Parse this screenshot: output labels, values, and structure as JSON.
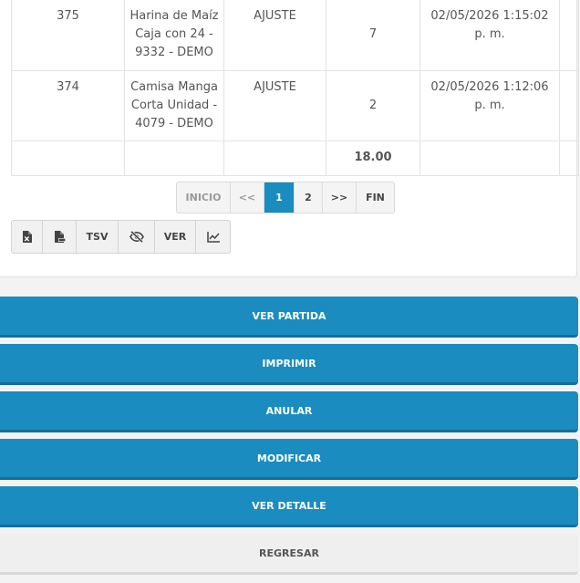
{
  "table": {
    "rows": [
      {
        "id": "375",
        "product": "Harina de Maíz Caja con 24 - 9332 - DEMO",
        "type": "AJUSTE",
        "qty": "7",
        "date": "02/05/2026 1:15:02 p. m."
      },
      {
        "id": "374",
        "product": "Camisa Manga Corta Unidad - 4079 - DEMO",
        "type": "AJUSTE",
        "qty": "2",
        "date": "02/05/2026 1:12:06 p. m."
      }
    ],
    "total": "18.00"
  },
  "pagination": {
    "first": "INICIO",
    "prev": "<<",
    "pages": [
      "1",
      "2"
    ],
    "current_page": "1",
    "next": ">>",
    "last": "FIN"
  },
  "toolbar": {
    "excel_icon": "excel-file-icon",
    "pdf_icon": "pdf-file-icon",
    "tsv_label": "TSV",
    "hide_icon": "eye-slash-icon",
    "ver_label": "VER",
    "chart_icon": "line-chart-icon"
  },
  "actions": {
    "ver_partida": "VER PARTIDA",
    "imprimir": "IMPRIMIR",
    "anular": "ANULAR",
    "modificar": "MODIFICAR",
    "ver_detalle": "VER DETALLE",
    "regresar": "REGRESAR"
  },
  "colors": {
    "primary": "#1a8cbf",
    "primary_border": "#137099",
    "secondary": "#efefef"
  }
}
